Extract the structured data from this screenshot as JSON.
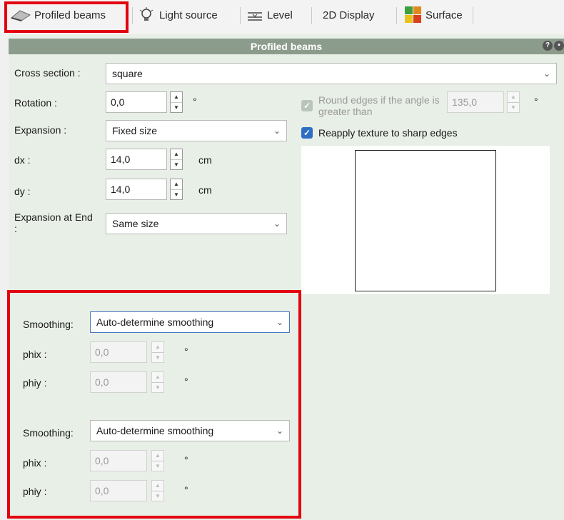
{
  "ribbon": {
    "tabs": [
      {
        "label": "Profiled beams",
        "icon": "profiled-beams-icon"
      },
      {
        "label": "Light source",
        "icon": "light-source-icon"
      },
      {
        "label": "Level",
        "icon": "level-icon"
      },
      {
        "label": "2D Display"
      },
      {
        "label": "Surface",
        "icon": "surface-icon"
      }
    ]
  },
  "panel": {
    "title": "Profiled beams",
    "cross_section": {
      "label": "Cross section :",
      "value": "square"
    },
    "rotation": {
      "label": "Rotation :",
      "value": "0,0",
      "unit": "°"
    },
    "expansion": {
      "label": "Expansion :",
      "value": "Fixed size"
    },
    "dx": {
      "label": "dx :",
      "value": "14,0",
      "unit": "cm"
    },
    "dy": {
      "label": "dy :",
      "value": "14,0",
      "unit": "cm"
    },
    "expansion_end": {
      "label": "Expansion at End :",
      "value": "Same size"
    },
    "round_edges": {
      "label": "Round edges if the angle is greater than",
      "value": "135,0",
      "unit": "°",
      "checked": true,
      "disabled": true
    },
    "reapply_texture": {
      "label": "Reapply texture to sharp edges",
      "checked": true
    },
    "smoothing_groups": [
      {
        "label": "Smoothing:",
        "value": "Auto-determine smoothing",
        "phix": {
          "label": "phix :",
          "value": "0,0",
          "unit": "°"
        },
        "phiy": {
          "label": "phiy :",
          "value": "0,0",
          "unit": "°"
        }
      },
      {
        "label": "Smoothing:",
        "value": "Auto-determine smoothing",
        "phix": {
          "label": "phix :",
          "value": "0,0",
          "unit": "°"
        },
        "phiy": {
          "label": "phiy :",
          "value": "0,0",
          "unit": "°"
        }
      }
    ]
  },
  "colors": {
    "highlight": "#e3000f",
    "panel_bg": "#e8efe6",
    "title_bar": "#8c9c8c",
    "checkbox": "#2f6fc3"
  }
}
